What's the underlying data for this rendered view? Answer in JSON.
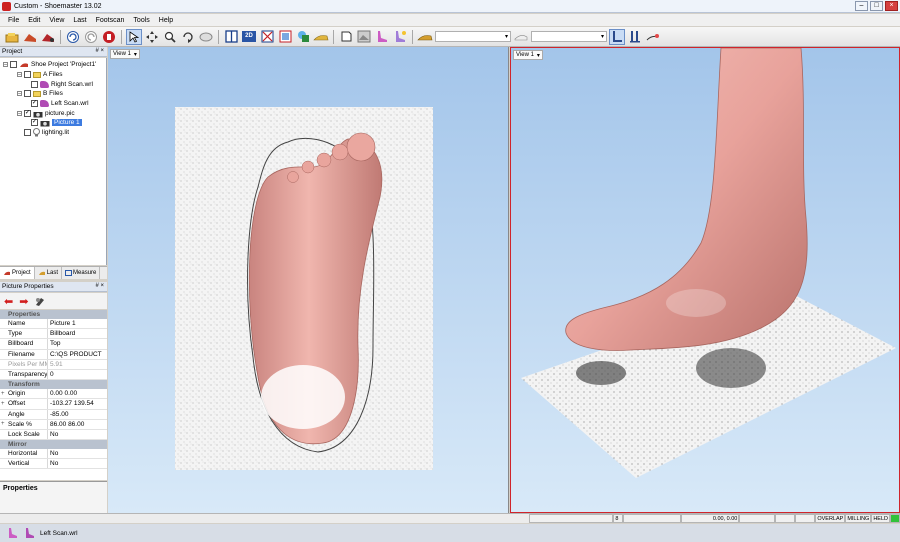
{
  "window": {
    "title": "Custom - Shoemaster 13.02",
    "min": "–",
    "max": "□",
    "close": "×"
  },
  "menu": [
    "File",
    "Edit",
    "View",
    "Last",
    "Footscan",
    "Tools",
    "Help"
  ],
  "toolbar": {
    "view_mode": "2D",
    "active_tool": "select-arrow"
  },
  "project_panel": {
    "title": "Project",
    "pin": "# ×",
    "tree": [
      {
        "label": "Shoe Project 'Project1'",
        "level": 0,
        "checked": false,
        "icon": "shoe-icon"
      },
      {
        "label": "A Files",
        "level": 1,
        "checked": false,
        "icon": "folder-icon"
      },
      {
        "label": "Right Scan.wrl",
        "level": 2,
        "checked": false,
        "icon": "foot-scan-icon"
      },
      {
        "label": "B Files",
        "level": 1,
        "checked": false,
        "icon": "folder-icon"
      },
      {
        "label": "Left Scan.wrl",
        "level": 2,
        "checked": true,
        "icon": "foot-scan-icon"
      },
      {
        "label": "picture.pic",
        "level": 1,
        "checked": true,
        "icon": "camera-icon"
      },
      {
        "label": "Picture 1",
        "level": 2,
        "checked": true,
        "icon": "camera-icon",
        "selected": true
      },
      {
        "label": "lighting.lit",
        "level": 1,
        "checked": false,
        "icon": "bulb-icon"
      }
    ],
    "tabs": [
      "Project",
      "Last",
      "Measure"
    ]
  },
  "picture_properties": {
    "title": "Picture Properties",
    "sections": [
      {
        "name": "Properties",
        "rows": [
          {
            "key": "Name",
            "value": "Picture 1"
          },
          {
            "key": "Type",
            "value": "Billboard"
          },
          {
            "key": "Billboard",
            "value": "Top"
          },
          {
            "key": "Filename",
            "value": "C:\\QS PRODUCT"
          },
          {
            "key": "Pixels Per MM",
            "value": "5.91",
            "disabled": true
          },
          {
            "key": "Transparency %",
            "value": "0"
          }
        ]
      },
      {
        "name": "Transform",
        "rows": [
          {
            "key": "Origin",
            "value": "0.00 0.00",
            "expandable": true
          },
          {
            "key": "Offset",
            "value": "-103.27 139.54",
            "expandable": true
          },
          {
            "key": "Angle",
            "value": "-85.00"
          },
          {
            "key": "Scale %",
            "value": "86.00 86.00",
            "expandable": true
          },
          {
            "key": "Lock Scale",
            "value": "No"
          }
        ]
      },
      {
        "name": "Mirror",
        "rows": [
          {
            "key": "Horizontal",
            "value": "No"
          },
          {
            "key": "Vertical",
            "value": "No"
          }
        ]
      }
    ],
    "description_title": "Properties"
  },
  "viewports": [
    {
      "label": "View 1"
    },
    {
      "label": "View 1",
      "active": true
    }
  ],
  "statusbar": {
    "num": "8",
    "coords": "0.00, 0.00",
    "flags": [
      "OVERLAP",
      "MILLING",
      "HELD"
    ]
  },
  "bottombar": {
    "file": "Left Scan.wrl"
  },
  "colors": {
    "accent": "#3d7be0",
    "active_view_border": "#d0242b",
    "foot_skin": "#e7a39d"
  }
}
